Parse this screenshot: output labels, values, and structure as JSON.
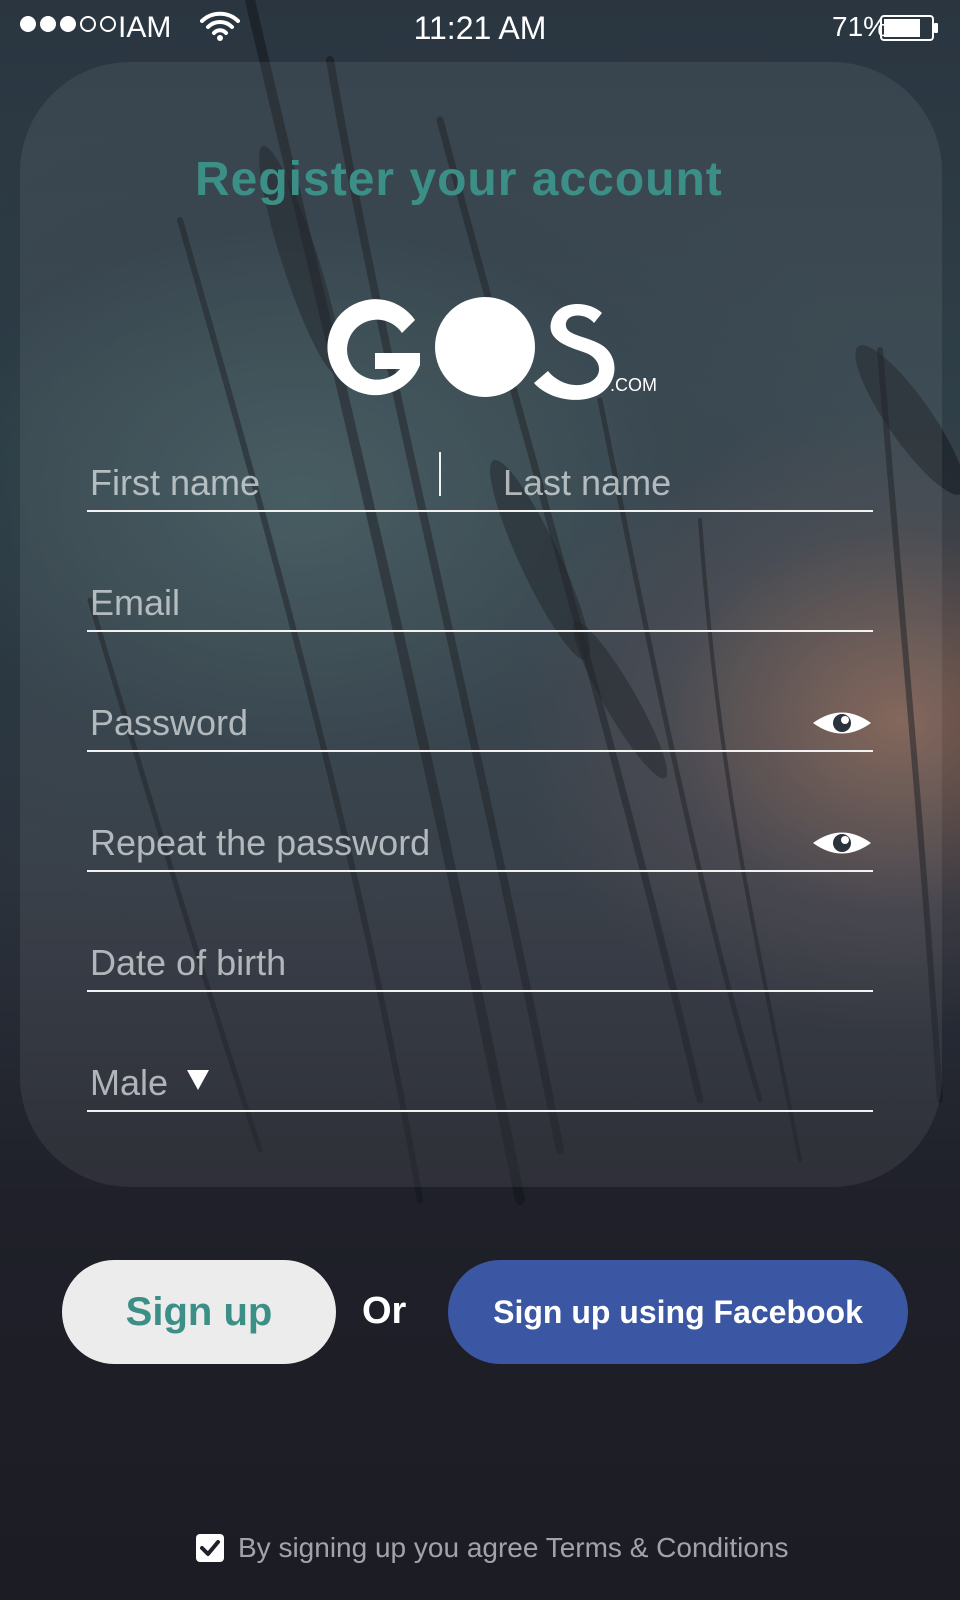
{
  "status_bar": {
    "carrier": "IAM",
    "time": "11:21 AM",
    "battery": "71%",
    "signal_bars_filled": 3,
    "signal_bars_total": 5
  },
  "form": {
    "title": "Register your account",
    "logo_text": "GOS",
    "logo_suffix": ".COM",
    "first_name_placeholder": "First name",
    "last_name_placeholder": "Last name",
    "email_placeholder": "Email",
    "password_placeholder": "Password",
    "repeat_password_placeholder": "Repeat the password",
    "dob_placeholder": "Date of birth",
    "gender_value": "Male"
  },
  "actions": {
    "signup_label": "Sign up",
    "or_label": "Or",
    "facebook_label": "Sign up using Facebook"
  },
  "terms": {
    "text": "By signing up you agree Terms & Conditions",
    "checked": true
  },
  "colors": {
    "accent": "#3c8f86",
    "facebook": "#3b56a3",
    "button_light": "#ececec"
  }
}
